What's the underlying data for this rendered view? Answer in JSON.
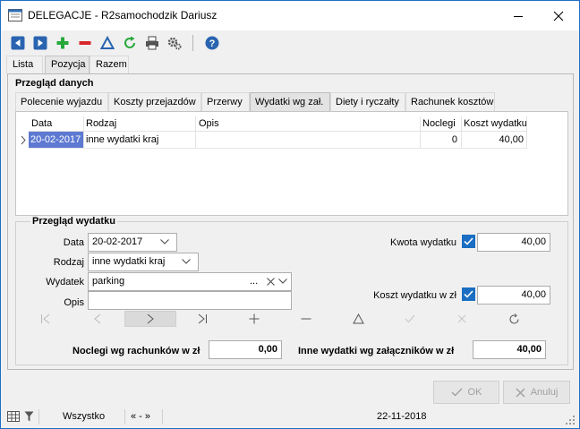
{
  "window": {
    "title": "DELEGACJE - R2samochodzik Dariusz",
    "minimize_icon": "minimize-icon",
    "close_icon": "close-icon"
  },
  "toolbar": {
    "icons": [
      "arrow-left-icon",
      "arrow-right-icon",
      "plus-icon",
      "minus-icon",
      "filter-triangle-icon",
      "refresh-icon",
      "print-icon",
      "settings-icon",
      "help-icon"
    ]
  },
  "top_tabs": [
    "Lista",
    "Pozycja",
    "Razem"
  ],
  "main": {
    "group_title": "Przegląd danych",
    "subtabs": [
      "Polecenie wyjazdu",
      "Koszty przejazdów",
      "Przerwy",
      "Wydatki wg zał.",
      "Diety i ryczałty",
      "Rachunek kosztów"
    ],
    "grid": {
      "columns": [
        "Data",
        "Rodzaj",
        "Opis",
        "Noclegi",
        "Koszt wydatku"
      ],
      "rows": [
        {
          "data": "20-02-2017",
          "rodzaj": "inne wydatki kraj",
          "opis": "",
          "noclegi": "0",
          "koszt": "40,00"
        }
      ]
    },
    "detail": {
      "title": "Przegląd wydatku",
      "data_label": "Data",
      "data_value": "20-02-2017",
      "rodzaj_label": "Rodzaj",
      "rodzaj_value": "inne wydatki kraj",
      "wydatek_label": "Wydatek",
      "wydatek_value": "parking",
      "wydatek_dots": "...",
      "opis_label": "Opis",
      "opis_value": "",
      "kwota_label": "Kwota wydatku",
      "kwota_value": "40,00",
      "koszt_label": "Koszt wydatku w zł",
      "koszt_value": "40,00"
    },
    "summary": {
      "noclegi_label": "Noclegi wg rachunków w zł",
      "noclegi_value": "0,00",
      "inne_label": "Inne wydatki wg załączników w zł",
      "inne_value": "40,00"
    }
  },
  "buttons": {
    "ok": "OK",
    "cancel": "Anuluj"
  },
  "status": {
    "filter": "Wszystko",
    "range": "« - »",
    "date": "22-11-2018"
  }
}
